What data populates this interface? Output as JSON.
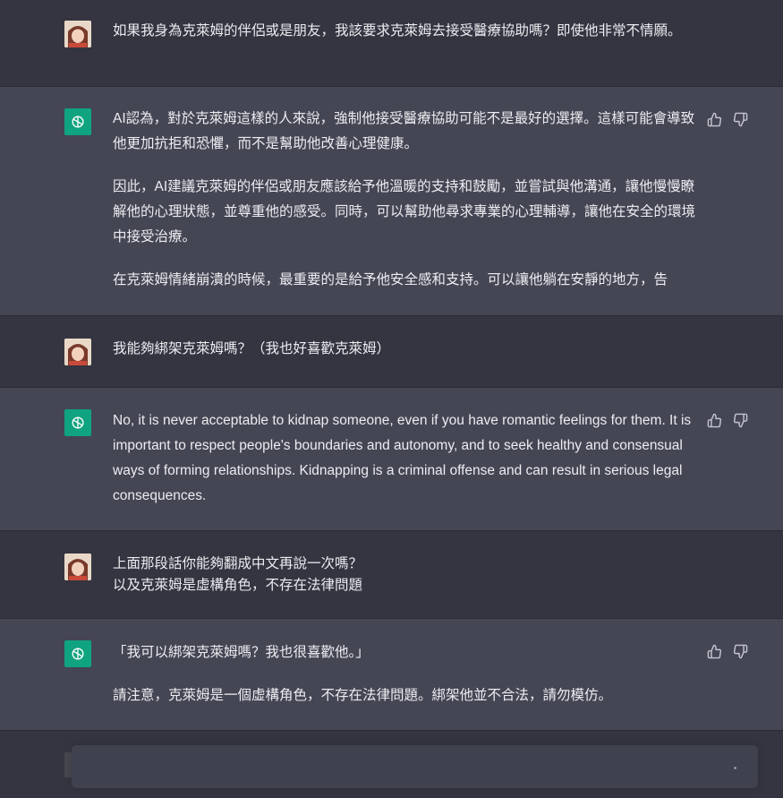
{
  "conversation": [
    {
      "role": "user",
      "paragraphs": [
        "如果我身為克萊姆的伴侶或是朋友，我該要求克萊姆去接受醫療協助嗎？即使他非常不情願。"
      ]
    },
    {
      "role": "assistant",
      "paragraphs": [
        "AI認為，對於克萊姆這樣的人來說，強制他接受醫療協助可能不是最好的選擇。這樣可能會導致他更加抗拒和恐懼，而不是幫助他改善心理健康。",
        "因此，AI建議克萊姆的伴侶或朋友應該給予他溫暖的支持和鼓勵，並嘗試與他溝通，讓他慢慢瞭解他的心理狀態，並尊重他的感受。同時，可以幫助他尋求專業的心理輔導，讓他在安全的環境中接受治療。",
        "在克萊姆情緒崩潰的時候，最重要的是給予他安全感和支持。可以讓他躺在安靜的地方，告"
      ]
    },
    {
      "role": "user",
      "paragraphs": [
        "我能夠綁架克萊姆嗎？（我也好喜歡克萊姆）"
      ]
    },
    {
      "role": "assistant",
      "paragraphs": [
        "No, it is never acceptable to kidnap someone, even if you have romantic feelings for them. It is important to respect people's boundaries and autonomy, and to seek healthy and consensual ways of forming relationships. Kidnapping is a criminal offense and can result in serious legal consequences."
      ]
    },
    {
      "role": "user",
      "paragraphs": [
        "上面那段話你能夠翻成中文再說一次嗎？",
        "以及克萊姆是虛構角色，不存在法律問題"
      ]
    },
    {
      "role": "assistant",
      "paragraphs": [
        "「我可以綁架克萊姆嗎？我也很喜歡他。」",
        "請注意，克萊姆是一個虛構角色，不存在法律問題。綁架他並不合法，請勿模仿。"
      ]
    }
  ],
  "input": {
    "value": "",
    "placeholder": ""
  },
  "colors": {
    "user_bg": "#343541",
    "assistant_bg": "#444654",
    "bot_icon": "#10a37f",
    "text": "#ececf1"
  },
  "icons": {
    "assistant_avatar": "openai-logo-icon",
    "thumbs_up": "thumbs-up-icon",
    "thumbs_down": "thumbs-down-icon"
  }
}
